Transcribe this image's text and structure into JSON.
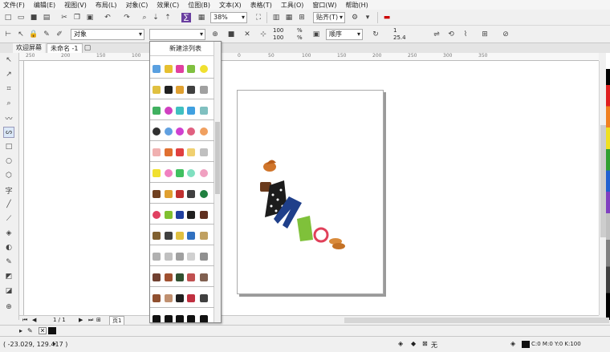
{
  "menu": [
    "文件(F)",
    "编辑(E)",
    "视图(V)",
    "布局(L)",
    "对象(C)",
    "效果(C)",
    "位图(B)",
    "文本(X)",
    "表格(T)",
    "工具(O)",
    "窗口(W)",
    "帮助(H)"
  ],
  "standard_toolbar": {
    "zoom": "38%",
    "snap": "贴齐(T)"
  },
  "property_bar": {
    "object_select": "对象",
    "scale_w": "100",
    "scale_h": "100",
    "percent_w": "%",
    "percent_h": "%",
    "order_select": "顺序",
    "nudge_x": "1",
    "nudge_y": "25.4"
  },
  "tabs": {
    "welcome": "欢迎屏幕",
    "doc": "未命名 -1"
  },
  "ruler": {
    "h_labels": [
      "250",
      "200",
      "150",
      "100",
      "50",
      "0",
      "50",
      "100",
      "150",
      "200",
      "250",
      "300",
      "350"
    ]
  },
  "docker": {
    "title": "新建涂列表"
  },
  "page_nav": {
    "counter": "1 / 1",
    "page_tab": "页1"
  },
  "status": {
    "coords": "( -23.029, 129.417 )",
    "fill_label": "无",
    "color_readout": "C:0 M:0 Y:0 K:100"
  },
  "colors": {
    "accent": "#1a5fb4",
    "page_shadow": "#9a9a9a"
  }
}
